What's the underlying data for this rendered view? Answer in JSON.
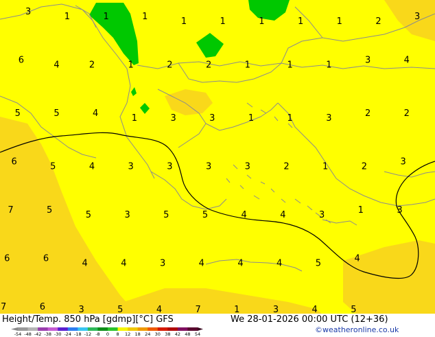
{
  "footer": {
    "title": "Height/Temp. 850 hPa [gdmp][°C] GFS",
    "datetime": "We 28-01-2026 00:00 UTC (12+36)",
    "credit": "©weatheronline.co.uk"
  },
  "colorbar": {
    "ticks": [
      "-54",
      "-48",
      "-42",
      "-38",
      "-30",
      "-24",
      "-18",
      "-12",
      "-8",
      "0",
      "8",
      "12",
      "18",
      "24",
      "30",
      "38",
      "42",
      "48",
      "54"
    ],
    "colors": [
      "#9a9a9a",
      "#b4b4b4",
      "#9b3fae",
      "#c55bd2",
      "#5a1fd0",
      "#2d7ef0",
      "#39c6f2",
      "#2fb95a",
      "#0e8e1a",
      "#2cc42c",
      "#f5f500",
      "#f0c800",
      "#ef9a00",
      "#ee5a00",
      "#d41a00",
      "#b00a0a",
      "#801060",
      "#5a0a30"
    ]
  },
  "map": {
    "colors": {
      "light_yellow": "#ffff00",
      "gold": "#f9d81a",
      "green": "#00c800",
      "contour": "#000000",
      "borders": "#8c8c8c"
    },
    "labels": [
      {
        "text": "3",
        "lon": 20.2,
        "lat": 42.6
      },
      {
        "text": "1",
        "lon": 21.3,
        "lat": 42.5
      },
      {
        "text": "1",
        "lon": 22.4,
        "lat": 42.5
      },
      {
        "text": "1",
        "lon": 23.5,
        "lat": 42.5
      },
      {
        "text": "1",
        "lon": 24.6,
        "lat": 42.4
      },
      {
        "text": "1",
        "lon": 25.7,
        "lat": 42.4
      },
      {
        "text": "1",
        "lon": 26.8,
        "lat": 42.4
      },
      {
        "text": "1",
        "lon": 27.9,
        "lat": 42.4
      },
      {
        "text": "1",
        "lon": 29.0,
        "lat": 42.4
      },
      {
        "text": "2",
        "lon": 30.1,
        "lat": 42.4
      },
      {
        "text": "3",
        "lon": 31.2,
        "lat": 42.5
      },
      {
        "text": "6",
        "lon": 20.0,
        "lat": 41.6
      },
      {
        "text": "4",
        "lon": 21.0,
        "lat": 41.5
      },
      {
        "text": "2",
        "lon": 22.0,
        "lat": 41.5
      },
      {
        "text": "1",
        "lon": 23.1,
        "lat": 41.5
      },
      {
        "text": "2",
        "lon": 24.2,
        "lat": 41.5
      },
      {
        "text": "2",
        "lon": 25.3,
        "lat": 41.5
      },
      {
        "text": "1",
        "lon": 26.4,
        "lat": 41.5
      },
      {
        "text": "1",
        "lon": 27.6,
        "lat": 41.5
      },
      {
        "text": "1",
        "lon": 28.7,
        "lat": 41.5
      },
      {
        "text": "3",
        "lon": 29.8,
        "lat": 41.6
      },
      {
        "text": "4",
        "lon": 30.9,
        "lat": 41.6
      },
      {
        "text": "5",
        "lon": 19.9,
        "lat": 40.5
      },
      {
        "text": "5",
        "lon": 21.0,
        "lat": 40.5
      },
      {
        "text": "4",
        "lon": 22.1,
        "lat": 40.5
      },
      {
        "text": "1",
        "lon": 23.2,
        "lat": 40.4
      },
      {
        "text": "3",
        "lon": 24.3,
        "lat": 40.4
      },
      {
        "text": "3",
        "lon": 25.4,
        "lat": 40.4
      },
      {
        "text": "1",
        "lon": 26.5,
        "lat": 40.4
      },
      {
        "text": "1",
        "lon": 27.6,
        "lat": 40.4
      },
      {
        "text": "3",
        "lon": 28.7,
        "lat": 40.4
      },
      {
        "text": "2",
        "lon": 29.8,
        "lat": 40.5
      },
      {
        "text": "2",
        "lon": 30.9,
        "lat": 40.5
      },
      {
        "text": "6",
        "lon": 19.8,
        "lat": 39.5
      },
      {
        "text": "5",
        "lon": 20.9,
        "lat": 39.4
      },
      {
        "text": "4",
        "lon": 22.0,
        "lat": 39.4
      },
      {
        "text": "3",
        "lon": 23.1,
        "lat": 39.4
      },
      {
        "text": "3",
        "lon": 24.2,
        "lat": 39.4
      },
      {
        "text": "3",
        "lon": 25.3,
        "lat": 39.4
      },
      {
        "text": "3",
        "lon": 26.4,
        "lat": 39.4
      },
      {
        "text": "2",
        "lon": 27.5,
        "lat": 39.4
      },
      {
        "text": "1",
        "lon": 28.6,
        "lat": 39.4
      },
      {
        "text": "2",
        "lon": 29.7,
        "lat": 39.4
      },
      {
        "text": "3",
        "lon": 30.8,
        "lat": 39.5
      },
      {
        "text": "7",
        "lon": 19.7,
        "lat": 38.5
      },
      {
        "text": "5",
        "lon": 20.8,
        "lat": 38.5
      },
      {
        "text": "5",
        "lon": 21.9,
        "lat": 38.4
      },
      {
        "text": "3",
        "lon": 23.0,
        "lat": 38.4
      },
      {
        "text": "5",
        "lon": 24.1,
        "lat": 38.4
      },
      {
        "text": "5",
        "lon": 25.2,
        "lat": 38.4
      },
      {
        "text": "4",
        "lon": 26.3,
        "lat": 38.4
      },
      {
        "text": "4",
        "lon": 27.4,
        "lat": 38.4
      },
      {
        "text": "3",
        "lon": 28.5,
        "lat": 38.4
      },
      {
        "text": "1",
        "lon": 29.6,
        "lat": 38.5
      },
      {
        "text": "3",
        "lon": 30.7,
        "lat": 38.5
      },
      {
        "text": "6",
        "lon": 19.6,
        "lat": 37.5
      },
      {
        "text": "6",
        "lon": 20.7,
        "lat": 37.5
      },
      {
        "text": "4",
        "lon": 21.8,
        "lat": 37.4
      },
      {
        "text": "4",
        "lon": 22.9,
        "lat": 37.4
      },
      {
        "text": "3",
        "lon": 24.0,
        "lat": 37.4
      },
      {
        "text": "4",
        "lon": 25.1,
        "lat": 37.4
      },
      {
        "text": "4",
        "lon": 26.2,
        "lat": 37.4
      },
      {
        "text": "4",
        "lon": 27.3,
        "lat": 37.4
      },
      {
        "text": "5",
        "lon": 28.4,
        "lat": 37.4
      },
      {
        "text": "4",
        "lon": 29.5,
        "lat": 37.5
      },
      {
        "text": "7",
        "lon": 19.5,
        "lat": 36.5
      },
      {
        "text": "6",
        "lon": 20.6,
        "lat": 36.5
      },
      {
        "text": "3",
        "lon": 21.7,
        "lat": 36.4
      },
      {
        "text": "5",
        "lon": 22.8,
        "lat": 36.4
      },
      {
        "text": "4",
        "lon": 23.9,
        "lat": 36.4
      },
      {
        "text": "7",
        "lon": 25.0,
        "lat": 36.4
      },
      {
        "text": "1",
        "lon": 26.1,
        "lat": 36.4
      },
      {
        "text": "3",
        "lon": 27.2,
        "lat": 36.4
      },
      {
        "text": "4",
        "lon": 28.3,
        "lat": 36.4
      },
      {
        "text": "5",
        "lon": 29.4,
        "lat": 36.4
      }
    ]
  }
}
